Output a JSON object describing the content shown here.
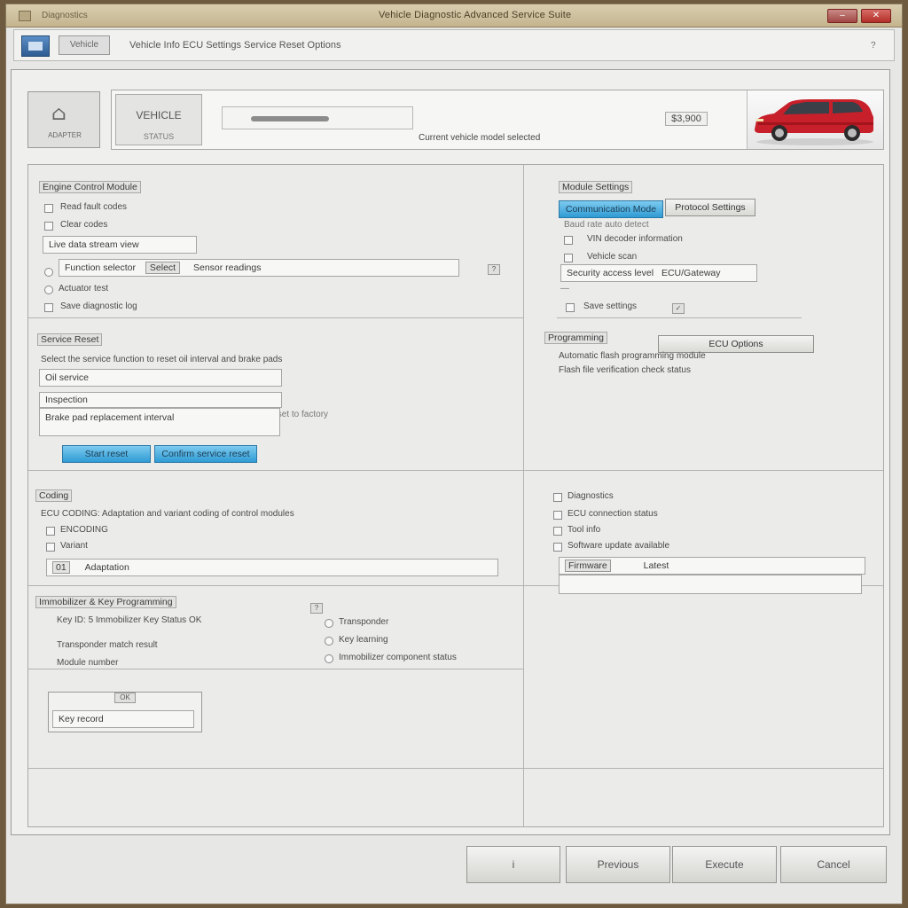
{
  "titlebar": {
    "app_label": "Diagnostics",
    "window_title": "Vehicle Diagnostic Advanced Service Suite",
    "min_label": "–",
    "close_label": "✕"
  },
  "toolbar": {
    "button_label": "Vehicle",
    "breadcrumb": "Vehicle Info  ECU Settings  Service Reset Options",
    "right_label": "?"
  },
  "header": {
    "icon_label": "ADAPTER",
    "box_title": "VEHICLE",
    "box_sub": "STATUS",
    "caption": "Current vehicle model selected",
    "price": "$3,900"
  },
  "left": {
    "s1": {
      "title": "Engine Control Module",
      "opt1": "Read fault codes",
      "opt2": "Clear codes",
      "field1": "Live data stream view",
      "row_label": "Function selector",
      "row_btn": "Select",
      "row_value": "Sensor readings",
      "row_tail": "?",
      "opt3": "Actuator test",
      "opt4": "Save diagnostic log"
    },
    "s2": {
      "title": "Service Reset",
      "desc": "Select the service function to reset oil interval and brake pads",
      "field1": "Oil service",
      "field2": "Inspection",
      "field2_hint": "Reset to factory",
      "field3": "Brake pad replacement interval",
      "btn1": "Start reset",
      "btn2": "Confirm service reset"
    },
    "s3": {
      "title": "Coding",
      "header": "ECU CODING: Adaptation and variant coding of control modules",
      "opt1": "ENCODING",
      "opt2": "Variant",
      "field_tag": "01",
      "field_value": "Adaptation"
    },
    "s4": {
      "title": "Immobilizer & Key Programming",
      "line1": "Key ID: 5 Immobilizer Key Status OK",
      "line2": "Transponder match result",
      "line3": "Module number",
      "opt1": "Transponder",
      "opt2": "Key learning",
      "opt3": "Immobilizer component status",
      "box_hint": "OK",
      "box_label": "Key record"
    }
  },
  "right": {
    "s1": {
      "title": "Module Settings",
      "btn_active": "Communication Mode",
      "btn2": "Protocol Settings",
      "line1": "Baud rate auto detect",
      "opt1": "VIN decoder information",
      "opt2": "Vehicle scan",
      "field_label": "Security access level",
      "field_value": "ECU/Gateway",
      "opt3": "Save settings"
    },
    "s2": {
      "title": "Programming",
      "btn": "ECU Options",
      "line1": "Automatic flash programming module",
      "line2": "Flash file verification check status"
    },
    "s3": {
      "opt1": "Diagnostics",
      "opt2": "ECU connection status",
      "opt3": "Tool info",
      "opt4": "Software update available",
      "field_tag": "Firmware",
      "field_value": "Latest"
    }
  },
  "footer": {
    "btn1": "i",
    "btn2": "Previous",
    "btn3": "Execute",
    "btn4": "Cancel"
  },
  "colors": {
    "accent_blue": "#2f9bd4",
    "titlebar": "#c4b58e",
    "car_red": "#c8202a"
  }
}
